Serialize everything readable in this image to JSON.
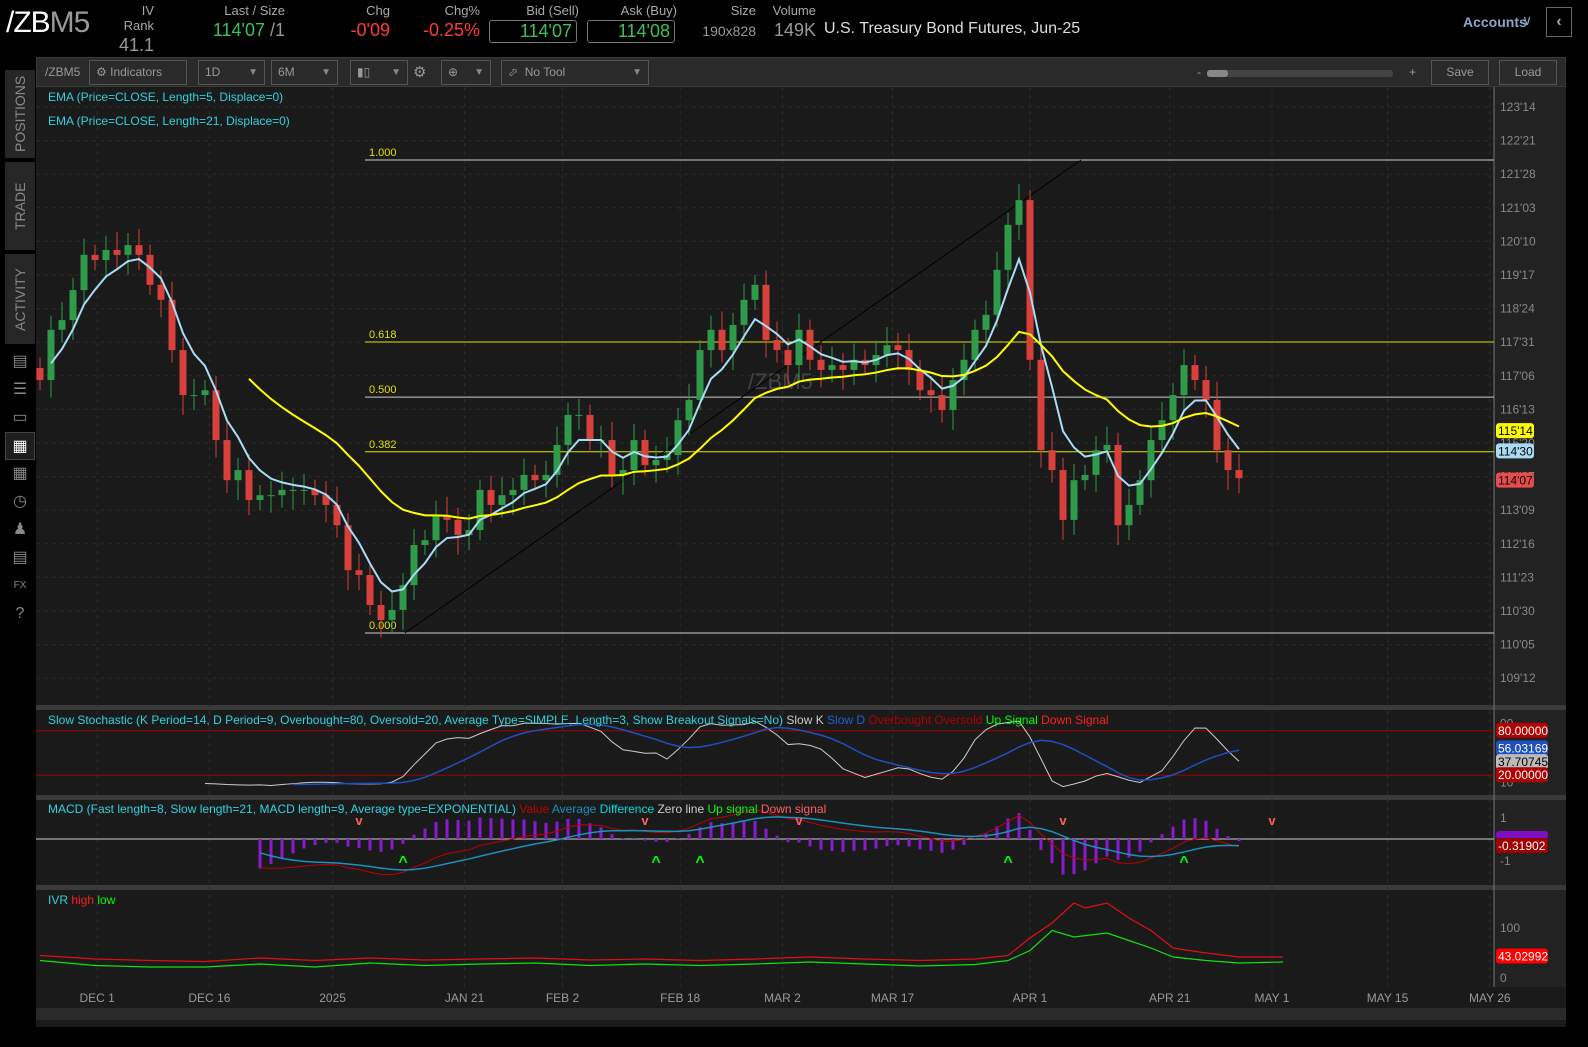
{
  "header": {
    "symbol_root": "/ZB",
    "symbol_month": "M5",
    "iv_rank": {
      "label": "IV Rank",
      "value": "41.1"
    },
    "last": {
      "label": "Last / Size",
      "price": "114'07",
      "size": "/1"
    },
    "chg": {
      "label": "Chg",
      "value": "-0'09"
    },
    "chg_pct": {
      "label": "Chg%",
      "value": "-0.25%"
    },
    "bid": {
      "label": "Bid (Sell)",
      "value": "114'07"
    },
    "ask": {
      "label": "Ask (Buy)",
      "value": "114'08"
    },
    "size": {
      "label": "Size",
      "value": "190x828"
    },
    "volume": {
      "label": "Volume",
      "value": "149K"
    },
    "description": "U.S. Treasury Bond Futures, Jun-25",
    "accounts": "Accounts"
  },
  "sidebar": {
    "tabs": [
      "POSITIONS",
      "TRADE",
      "ACTIVITY"
    ],
    "icons": [
      "news-icon",
      "watchlist-icon",
      "tv-icon",
      "chart-icon",
      "grid-icon",
      "clock-icon",
      "community-icon",
      "calendar-icon",
      "fx-icon",
      "help-icon"
    ]
  },
  "toolbar": {
    "symbol": "/ZBM5",
    "indicators": "Indicators",
    "aggregation": "1D",
    "timeframe": "6M",
    "tool": "No Tool",
    "zoom_minus": "-",
    "zoom_plus": "+",
    "zoom_level": 0.1,
    "save": "Save",
    "load": "Load"
  },
  "price_pane": {
    "studies": [
      "EMA (Price=CLOSE, Length=5, Displace=0)",
      "EMA (Price=CLOSE, Length=21, Displace=0)"
    ],
    "watermark": "/ZBM5",
    "y_ticks": [
      "123'14",
      "122'21",
      "121'28",
      "121'03",
      "120'10",
      "119'17",
      "118'24",
      "117'31",
      "117'06",
      "116'13",
      "115'20",
      "114'27",
      "113'09",
      "112'16",
      "111'23",
      "110'30",
      "110'05",
      "109'12"
    ],
    "markers": [
      {
        "label": "115'14",
        "color": "#ffff00"
      },
      {
        "label": "114'30",
        "color": "#a8dcf5"
      },
      {
        "label": "114'07",
        "color": "#e84c4c"
      }
    ],
    "fib": [
      {
        "label": "1.000",
        "price": 122.13
      },
      {
        "label": "0.618",
        "price": 117.64
      },
      {
        "label": "0.500",
        "price": 116.28
      },
      {
        "label": "0.382",
        "price": 114.93
      },
      {
        "label": "0.000",
        "price": 110.46
      }
    ]
  },
  "x_ticks": [
    {
      "label": "DEC 1",
      "i": 5.2
    },
    {
      "label": "DEC 16",
      "i": 15.4
    },
    {
      "label": "2025",
      "i": 26.6
    },
    {
      "label": "JAN 21",
      "i": 38.6
    },
    {
      "label": "FEB 2",
      "i": 47.5
    },
    {
      "label": "FEB 18",
      "i": 58.2
    },
    {
      "label": "MAR 2",
      "i": 67.5
    },
    {
      "label": "MAR 17",
      "i": 77.5
    },
    {
      "label": "APR 1",
      "i": 90
    },
    {
      "label": "APR 21",
      "i": 102.7
    },
    {
      "label": "MAY 1",
      "i": 112
    },
    {
      "label": "MAY 15",
      "i": 122.5
    },
    {
      "label": "MAY 26",
      "i": 131.8
    }
  ],
  "stoch": {
    "title": "Slow Stochastic (K Period=14, D Period=9, Overbought=80, Oversold=20, Average Type=SIMPLE, Length=3, Show Breakout Signals=No)",
    "legend": [
      {
        "t": "Slow K",
        "c": "#cccccc"
      },
      {
        "t": "Slow D",
        "c": "#1f5fd6"
      },
      {
        "t": "Overbought",
        "c": "#b00000"
      },
      {
        "t": "Oversold",
        "c": "#b00000"
      },
      {
        "t": "Up Signal",
        "c": "#00ff00"
      },
      {
        "t": "Down Signal",
        "c": "#ff2020"
      }
    ],
    "ticks": [
      "90",
      "10"
    ],
    "markers": [
      {
        "label": "80.00000",
        "color": "#b00000"
      },
      {
        "label": "56.03169",
        "color": "#1f50c0"
      },
      {
        "label": "37.70745",
        "color": "#bbbbbb"
      },
      {
        "label": "20.00000",
        "color": "#b00000"
      }
    ]
  },
  "macd": {
    "title": "MACD (Fast length=8, Slow length=21, MACD length=9, Average type=EXPONENTIAL)",
    "legend": [
      {
        "t": "Value",
        "c": "#c00000"
      },
      {
        "t": "Average",
        "c": "#1a90c0"
      },
      {
        "t": "Difference",
        "c": "#00dddd"
      },
      {
        "t": "Zero line",
        "c": "#cccccc"
      },
      {
        "t": "Up signal",
        "c": "#00ff00"
      },
      {
        "t": "Down signal",
        "c": "#ff6060"
      }
    ],
    "ticks": [
      "1",
      "-1"
    ],
    "markers": [
      {
        "label": "-0.31902",
        "color": "#a00000"
      }
    ]
  },
  "ivr": {
    "title": "IVR",
    "legend": [
      {
        "t": "high",
        "c": "#ff2020"
      },
      {
        "t": "low",
        "c": "#00ff00"
      }
    ],
    "ticks": [
      "100",
      "0"
    ],
    "markers": [
      {
        "label": "43.02992",
        "color": "#ff0000"
      }
    ]
  },
  "chart_data": {
    "type": "candlestick",
    "note": "daily closes, /ZBM5",
    "ylim": [
      109.375,
      123.4375
    ],
    "closes": [
      116.7,
      117.94,
      118.18,
      118.92,
      119.79,
      119.66,
      119.91,
      119.79,
      120.03,
      119.79,
      119.05,
      118.68,
      117.44,
      116.33,
      116.33,
      116.45,
      115.22,
      114.23,
      114.48,
      113.74,
      113.86,
      113.86,
      113.99,
      113.99,
      113.99,
      113.86,
      113.62,
      113.12,
      112.01,
      111.89,
      111.15,
      110.78,
      111.03,
      111.64,
      112.63,
      112.75,
      113.37,
      113.25,
      112.88,
      113.0,
      113.99,
      113.62,
      113.86,
      113.99,
      114.36,
      114.23,
      114.36,
      115.1,
      115.84,
      115.84,
      115.22,
      115.22,
      114.36,
      114.48,
      115.22,
      114.6,
      114.73,
      114.85,
      115.71,
      116.21,
      117.44,
      117.94,
      117.44,
      118.06,
      118.68,
      119.05,
      117.69,
      117.44,
      117.07,
      117.94,
      117.2,
      116.95,
      117.07,
      116.95,
      117.2,
      117.07,
      117.32,
      117.56,
      117.44,
      116.95,
      116.45,
      116.33,
      115.96,
      116.7,
      117.2,
      117.94,
      118.31,
      119.42,
      120.53,
      121.14,
      117.2,
      114.97,
      114.48,
      113.25,
      114.23,
      114.36,
      114.97,
      115.1,
      113.12,
      113.62,
      114.23,
      115.22,
      115.71,
      116.33,
      117.07,
      116.7,
      116.21,
      114.97,
      114.48,
      114.28
    ],
    "ivr_high": [
      [
        0,
        45
      ],
      [
        5,
        38
      ],
      [
        10,
        35
      ],
      [
        15,
        33
      ],
      [
        20,
        40
      ],
      [
        25,
        35
      ],
      [
        30,
        40
      ],
      [
        35,
        36
      ],
      [
        40,
        38
      ],
      [
        45,
        40
      ],
      [
        50,
        36
      ],
      [
        55,
        38
      ],
      [
        60,
        35
      ],
      [
        65,
        38
      ],
      [
        70,
        42
      ],
      [
        75,
        38
      ],
      [
        80,
        35
      ],
      [
        85,
        38
      ],
      [
        88,
        45
      ],
      [
        90,
        80
      ],
      [
        92,
        110
      ],
      [
        94,
        150
      ],
      [
        95,
        140
      ],
      [
        97,
        150
      ],
      [
        99,
        120
      ],
      [
        101,
        95
      ],
      [
        103,
        60
      ],
      [
        106,
        50
      ],
      [
        109,
        42
      ],
      [
        113,
        42
      ]
    ],
    "ivr_low": [
      [
        0,
        35
      ],
      [
        5,
        25
      ],
      [
        10,
        22
      ],
      [
        15,
        22
      ],
      [
        20,
        28
      ],
      [
        25,
        22
      ],
      [
        30,
        30
      ],
      [
        35,
        25
      ],
      [
        40,
        28
      ],
      [
        45,
        30
      ],
      [
        50,
        25
      ],
      [
        55,
        28
      ],
      [
        60,
        25
      ],
      [
        65,
        28
      ],
      [
        70,
        32
      ],
      [
        75,
        28
      ],
      [
        80,
        24
      ],
      [
        85,
        27
      ],
      [
        88,
        35
      ],
      [
        90,
        55
      ],
      [
        92,
        95
      ],
      [
        94,
        82
      ],
      [
        97,
        90
      ],
      [
        99,
        75
      ],
      [
        101,
        60
      ],
      [
        103,
        42
      ],
      [
        106,
        35
      ],
      [
        109,
        30
      ],
      [
        113,
        32
      ]
    ],
    "macd_up_signals": [
      33,
      56,
      60,
      88,
      104
    ],
    "macd_down_signals": [
      29,
      55,
      69,
      93,
      112
    ]
  }
}
